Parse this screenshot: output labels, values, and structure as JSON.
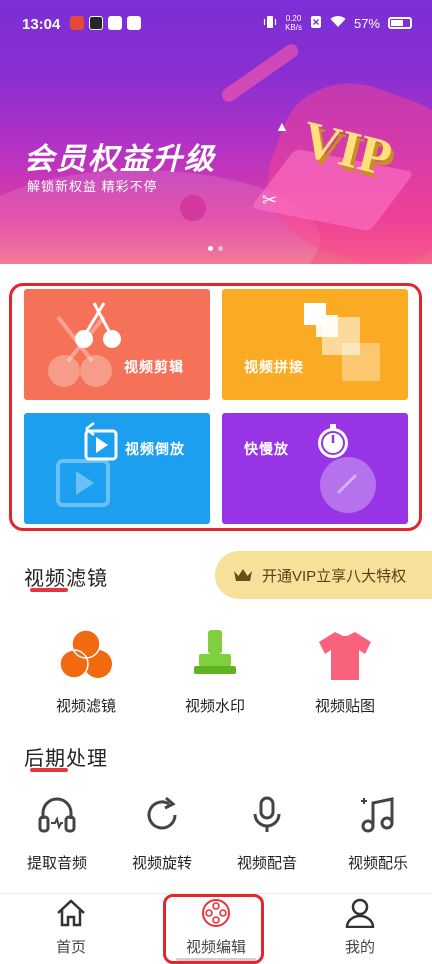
{
  "status_bar": {
    "time": "13:04",
    "speed_top": "0.20",
    "speed_bottom": "KB/s",
    "battery": "57%"
  },
  "banner": {
    "title": "会员权益升级",
    "subtitle": "解锁新权益 精彩不停",
    "badge": "VIP",
    "page_count": 2,
    "active_page": 1
  },
  "tiles": [
    {
      "label": "视频剪辑",
      "color": "#f57158",
      "icon": "scissors-icon"
    },
    {
      "label": "视频拼接",
      "color": "#fbab23",
      "icon": "stack-squares-icon"
    },
    {
      "label": "视频倒放",
      "color": "#1d9ff0",
      "icon": "reverse-play-icon"
    },
    {
      "label": "快慢放",
      "color": "#9734e5",
      "icon": "speed-dial-icon"
    }
  ],
  "filter_section": {
    "title": "视频滤镜",
    "vip_promo": "开通VIP立享八大特权",
    "items": [
      {
        "label": "视频滤镜",
        "icon": "color-circles-icon"
      },
      {
        "label": "视频水印",
        "icon": "stamp-icon"
      },
      {
        "label": "视频贴图",
        "icon": "tshirt-icon"
      }
    ]
  },
  "post_section": {
    "title": "后期处理",
    "items": [
      {
        "label": "提取音频",
        "icon": "headphones-icon"
      },
      {
        "label": "视频旋转",
        "icon": "rotate-icon"
      },
      {
        "label": "视频配音",
        "icon": "microphone-icon"
      },
      {
        "label": "视频配乐",
        "icon": "music-note-icon"
      }
    ]
  },
  "bottom_nav": {
    "items": [
      {
        "label": "首页",
        "icon": "home-icon"
      },
      {
        "label": "视频编辑",
        "icon": "film-reel-icon",
        "active": true
      },
      {
        "label": "我的",
        "icon": "person-icon"
      }
    ]
  },
  "colors": {
    "accent_red": "#e8343d",
    "vip_gold": "#f7e19a"
  }
}
